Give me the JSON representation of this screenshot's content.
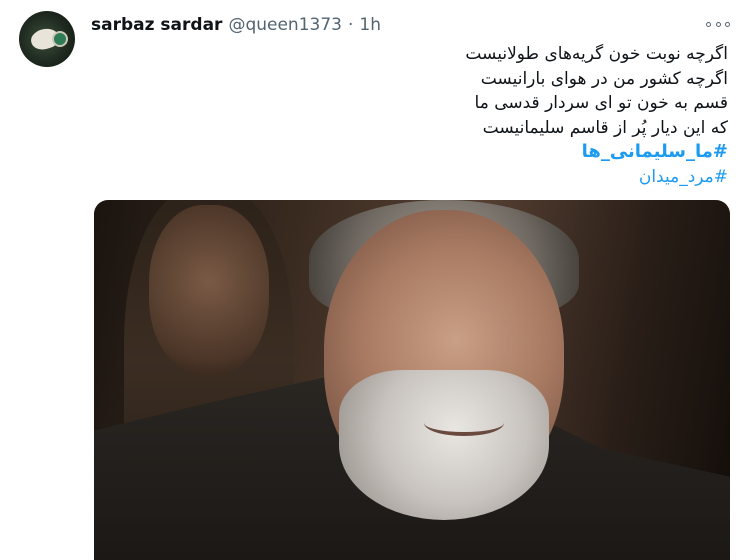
{
  "tweet": {
    "author_name": "sarbaz sardar",
    "author_handle": "@queen1373",
    "separator": "·",
    "time": "1h",
    "lines": [
      "اگرچه نوبت خون گریه‌های طولانیست",
      "اگرچه کشور من در هوای بارانیست",
      "قسم به خون تو ای سردار قدسی ما",
      "که این دیار پُر از قاسم سلیمانیست"
    ],
    "hashtag_1": "#ما_سلیمانی_ها",
    "hashtag_2": "#مرد_میدان"
  },
  "icons": {
    "more": "more-horizontal-icon"
  },
  "colors": {
    "link": "#1d9bf0",
    "muted": "#536471"
  }
}
